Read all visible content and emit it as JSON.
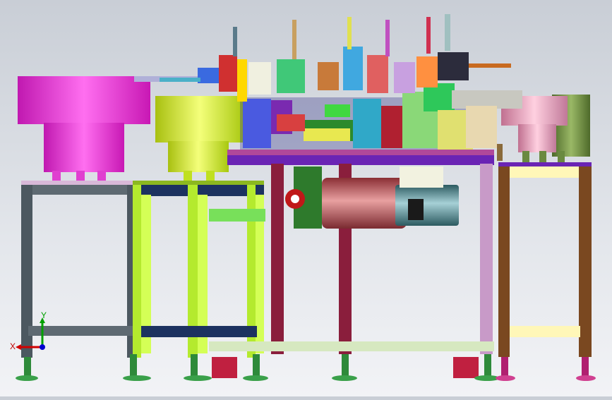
{
  "viewport": {
    "background_colors": [
      "#c9ced6",
      "#f2f3f6"
    ]
  },
  "triad": {
    "x_label": "X",
    "y_label": "Y",
    "x_color": "#d10000",
    "y_color": "#00a000",
    "z_color": "#0000d0"
  },
  "palette": {
    "magenta_bowl": "#ff2fe0",
    "yellow_bowl": "#d8f21a",
    "pink_bowl": "#f2a0c0",
    "green_bowl": "#7b9a4a",
    "frame_grey": "#5e6a72",
    "frame_green": "#b4ea2e",
    "frame_navy": "#1c3260",
    "frame_maroon": "#8a1e3c",
    "frame_brown": "#7a4820",
    "table_purple": "#6a24b4",
    "motor_red": "#c2565a",
    "motor_teal": "#4e8c94"
  }
}
